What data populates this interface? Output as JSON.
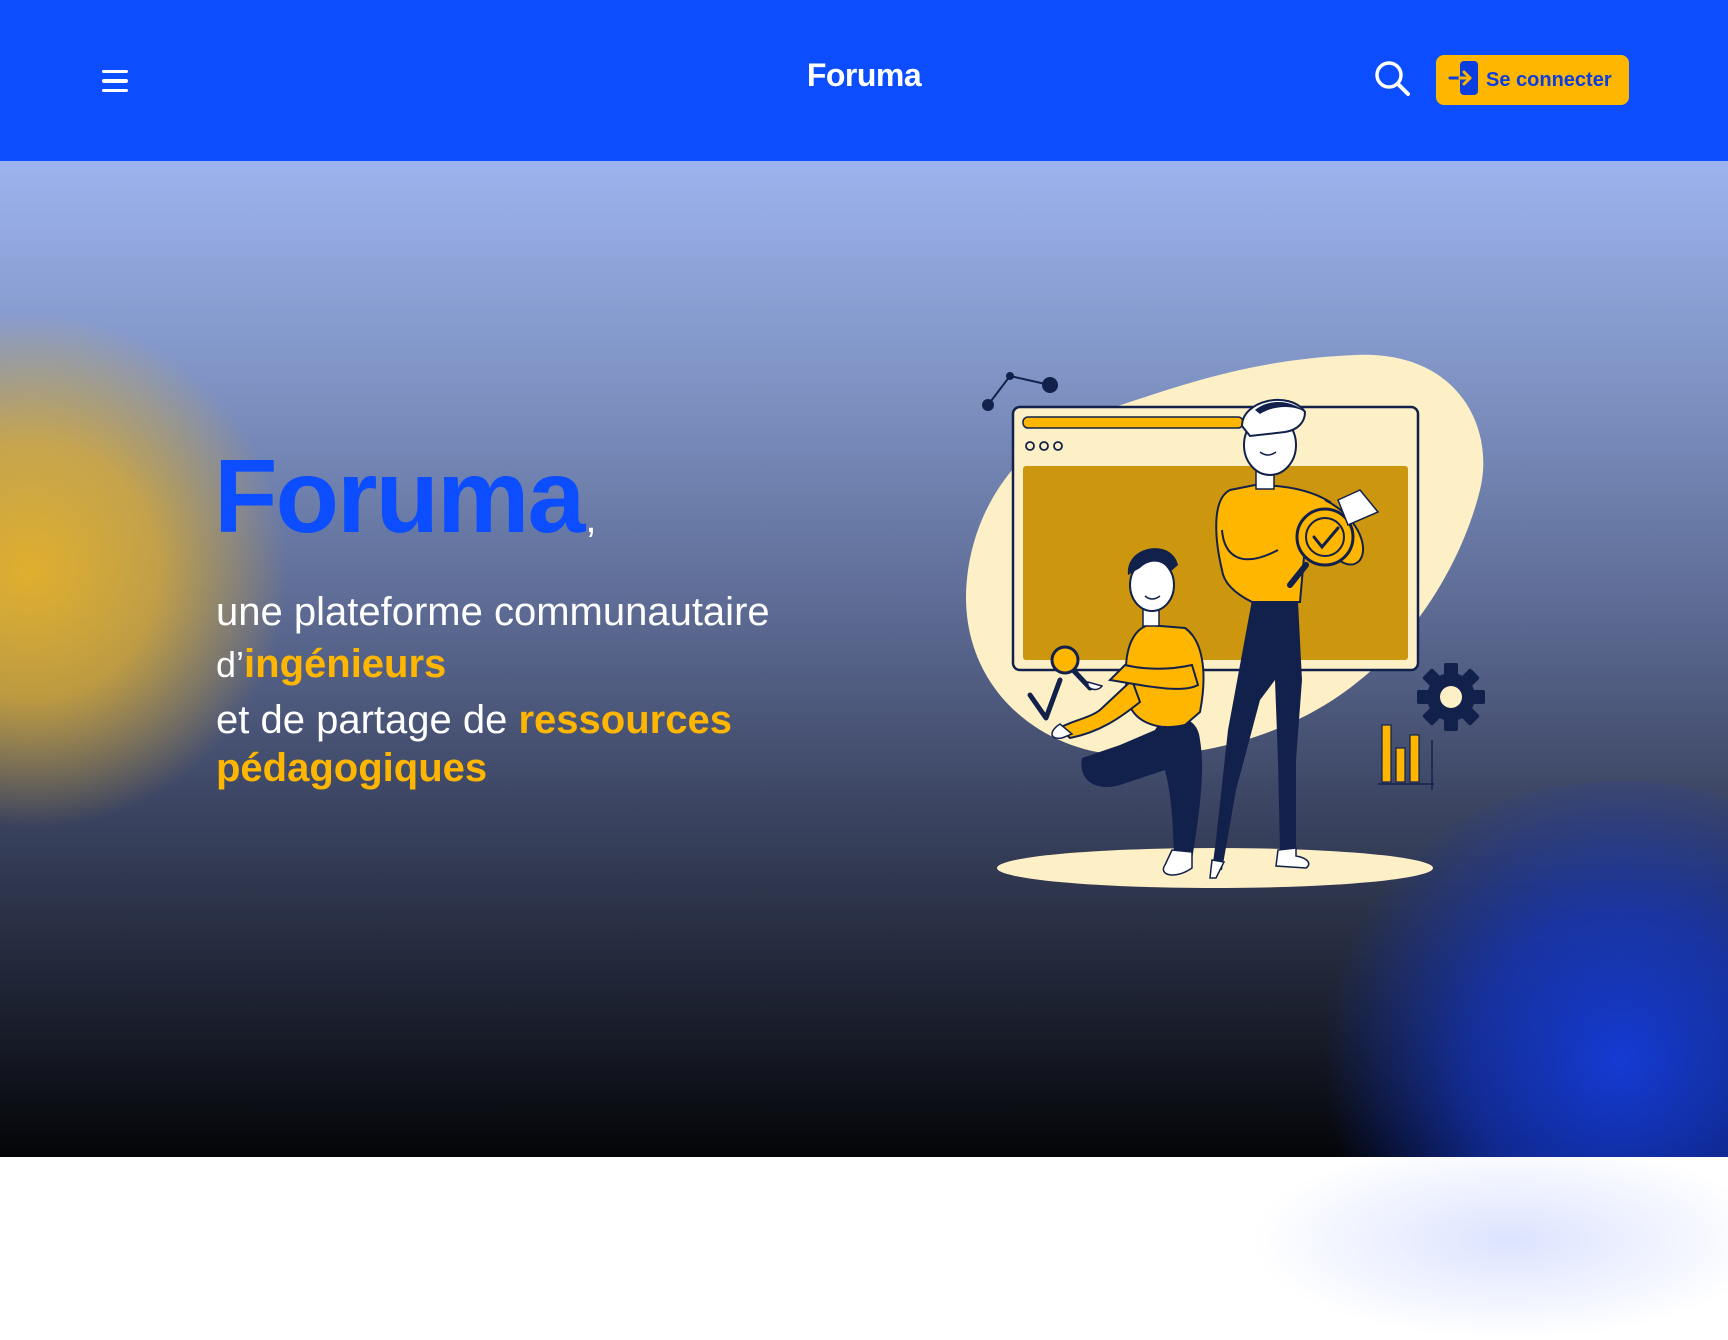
{
  "header": {
    "brand": "Foruma",
    "login_label": "Se connecter",
    "icons": {
      "menu": "hamburger-menu-icon",
      "search": "search-icon",
      "login": "login-arrow-icon"
    }
  },
  "hero": {
    "title": "Foruma",
    "title_comma": ",",
    "line1": "une plateforme communautaire",
    "line2_prefix": "d’",
    "line2_highlight": "ingénieurs",
    "line3_prefix": "et de partage de ",
    "line3_highlight": "ressources",
    "line4_highlight": "pédagogiques"
  },
  "colors": {
    "primary_blue": "#0b4dff",
    "accent_yellow": "#ffb600",
    "navy": "#12214b",
    "cream": "#fdf0c6"
  }
}
